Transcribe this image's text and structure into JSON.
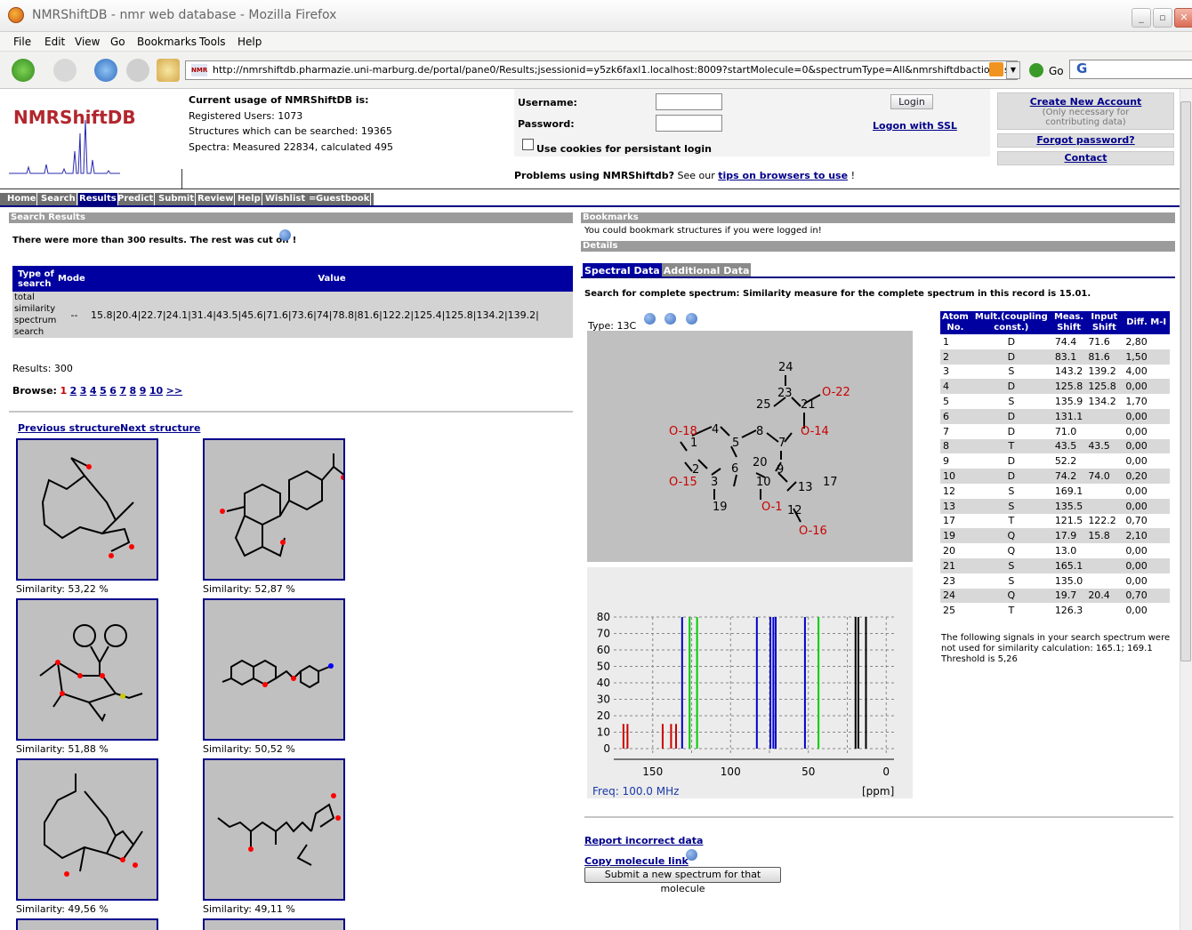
{
  "window": {
    "title": "NMRShiftDB - nmr web database - Mozilla Firefox"
  },
  "menu": [
    "File",
    "Edit",
    "View",
    "Go",
    "Bookmarks",
    "Tools",
    "Help"
  ],
  "browser": {
    "url": "http://nmrshiftdb.pharmazie.uni-marburg.de/portal/pane0/Results;jsessionid=y5zk6faxl1.localhost:8009?startMolecule=0&spectrumType=All&nmrshiftdbaction=showDetails",
    "go_label": "Go",
    "search_logo": "G"
  },
  "site": {
    "logo": "NMRShiftDB",
    "usage_title": "Current usage of NMRShiftDB is:",
    "registered_users": "Registered Users: 1073",
    "structures": "Structures which can be searched: 19365",
    "spectra": "Spectra: Measured 22834, calculated 495"
  },
  "login": {
    "username_label": "Username:",
    "password_label": "Password:",
    "login_button": "Login",
    "ssl_link": "Logon with SSL",
    "cookies_label": "Use cookies for persistant login",
    "problems_prefix": "Problems using NMRShiftdb?",
    "problems_see": "See our",
    "problems_link": "tips on browsers to use",
    "problems_suffix": "!"
  },
  "account": {
    "create": "Create New Account",
    "create_note": "(Only necessary for contributing data)",
    "forgot": "Forgot password?",
    "contact": "Contact"
  },
  "tabs": [
    "Home",
    "Search",
    "Results",
    "Predict",
    "Submit",
    "Review",
    "Help",
    "Wishlist",
    "Guestbook"
  ],
  "active_tab": "Results",
  "results": {
    "header": "Search Results",
    "cutoff": "There were more than 300 results. The rest was cut off !",
    "table_headers": {
      "type": "Type of search",
      "mode": "Mode",
      "value": "Value"
    },
    "row": {
      "type": "total similarity spectrum search",
      "mode": "--",
      "value": "15.8|20.4|22.7|24.1|31.4|43.5|45.6|71.6|73.6|74|78.8|81.6|122.2|125.4|125.8|134.2|139.2|"
    },
    "count": "Results: 300",
    "browse_label": "Browse:",
    "pages": [
      "1",
      "2",
      "3",
      "4",
      "5",
      "6",
      "7",
      "8",
      "9",
      "10",
      ">>"
    ],
    "prev": "Previous structure",
    "next": "Next structure",
    "similarities": [
      "Similarity: 53,22 %",
      "Similarity: 52,87 %",
      "Similarity: 51,88 %",
      "Similarity: 50,52 %",
      "Similarity: 49,56 %",
      "Similarity: 49,11 %"
    ]
  },
  "bookmarks": {
    "header": "Bookmarks",
    "text": "You could bookmark structures if you were logged in!"
  },
  "details": {
    "header": "Details",
    "tab_spectral": "Spectral Data",
    "tab_additional": "Additional Data",
    "similarity_text": "Search for complete spectrum: Similarity measure for the complete spectrum in this record is 15.01.",
    "type": "Type: 13C",
    "freq": "Freq: 100.0 MHz",
    "ppm": "[ppm]",
    "table_headers": [
      "Atom No.",
      "Mult.(coupling const.)",
      "Meas. Shift",
      "Input Shift",
      "Diff. M-I"
    ],
    "rows": [
      [
        "1",
        "D",
        "74.4",
        "71.6",
        "2,80"
      ],
      [
        "2",
        "D",
        "83.1",
        "81.6",
        "1,50"
      ],
      [
        "3",
        "S",
        "143.2",
        "139.2",
        "4,00"
      ],
      [
        "4",
        "D",
        "125.8",
        "125.8",
        "0,00"
      ],
      [
        "5",
        "S",
        "135.9",
        "134.2",
        "1,70"
      ],
      [
        "6",
        "D",
        "131.1",
        "",
        "0,00"
      ],
      [
        "7",
        "D",
        "71.0",
        "",
        "0,00"
      ],
      [
        "8",
        "T",
        "43.5",
        "43.5",
        "0,00"
      ],
      [
        "9",
        "D",
        "52.2",
        "",
        "0,00"
      ],
      [
        "10",
        "D",
        "74.2",
        "74.0",
        "0,20"
      ],
      [
        "12",
        "S",
        "169.1",
        "",
        "0,00"
      ],
      [
        "13",
        "S",
        "135.5",
        "",
        "0,00"
      ],
      [
        "17",
        "T",
        "121.5",
        "122.2",
        "0,70"
      ],
      [
        "19",
        "Q",
        "17.9",
        "15.8",
        "2,10"
      ],
      [
        "20",
        "Q",
        "13.0",
        "",
        "0,00"
      ],
      [
        "21",
        "S",
        "165.1",
        "",
        "0,00"
      ],
      [
        "23",
        "S",
        "135.0",
        "",
        "0,00"
      ],
      [
        "24",
        "Q",
        "19.7",
        "20.4",
        "0,70"
      ],
      [
        "25",
        "T",
        "126.3",
        "",
        "0,00"
      ]
    ],
    "note": "The following signals in your search spectrum were not used for similarity calculation: 165.1; 169.1 Threshold is 5,26",
    "report": "Report incorrect data",
    "copy": "Copy molecule link",
    "submit_new": "Submit a new spectrum for that molecule"
  },
  "spectrum": {
    "x_ticks": [
      150,
      100,
      50,
      0
    ],
    "y_ticks": [
      0,
      10,
      20,
      30,
      40,
      50,
      60,
      70,
      80
    ],
    "x_range": [
      175,
      -5
    ],
    "y_range": [
      0,
      80
    ],
    "peaks": [
      {
        "x": 168.8,
        "y": 15,
        "color": "#cc0000"
      },
      {
        "x": 166.2,
        "y": 15,
        "color": "#cc0000"
      },
      {
        "x": 143.6,
        "y": 15,
        "color": "#cc0000"
      },
      {
        "x": 138.2,
        "y": 15,
        "color": "#cc0000"
      },
      {
        "x": 135.0,
        "y": 15,
        "color": "#cc0000"
      },
      {
        "x": 131.1,
        "y": 80,
        "color": "#0000cc"
      },
      {
        "x": 126.3,
        "y": 80,
        "color": "#00cc00"
      },
      {
        "x": 121.5,
        "y": 80,
        "color": "#00cc00"
      },
      {
        "x": 83.1,
        "y": 80,
        "color": "#0000cc"
      },
      {
        "x": 74.4,
        "y": 80,
        "color": "#0000cc"
      },
      {
        "x": 72.5,
        "y": 80,
        "color": "#0000cc"
      },
      {
        "x": 71.0,
        "y": 80,
        "color": "#0000cc"
      },
      {
        "x": 52.2,
        "y": 80,
        "color": "#0000cc"
      },
      {
        "x": 43.5,
        "y": 80,
        "color": "#00cc00"
      },
      {
        "x": 19.7,
        "y": 80,
        "color": "#000000"
      },
      {
        "x": 17.9,
        "y": 80,
        "color": "#000000"
      },
      {
        "x": 13.0,
        "y": 80,
        "color": "#000000"
      }
    ]
  },
  "molecule_labels": [
    "24",
    "23",
    "25",
    "21",
    "O-22",
    "O-14",
    "O-18",
    "4",
    "5",
    "8",
    "7",
    "1",
    "20",
    "9",
    "O-15",
    "2",
    "6",
    "10",
    "13",
    "17",
    "3",
    "19",
    "O-1",
    "12",
    "O-16"
  ]
}
